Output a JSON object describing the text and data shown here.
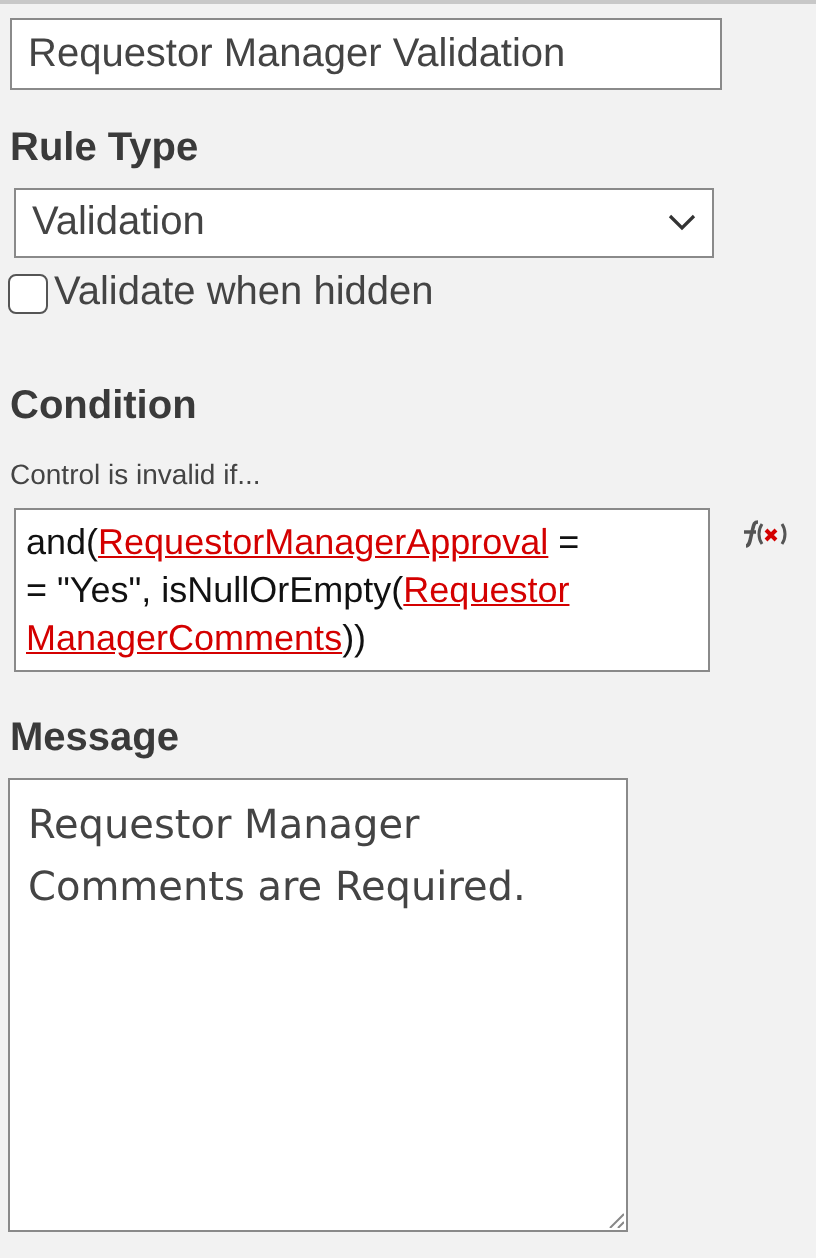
{
  "rule_name": {
    "value": "Requestor Manager Validation"
  },
  "rule_type": {
    "label": "Rule Type",
    "value": "Validation"
  },
  "validate_when_hidden": {
    "label": "Validate when hidden",
    "checked": false
  },
  "condition": {
    "label": "Condition",
    "hint": "Control is invalid if...",
    "expression_lines": [
      [
        {
          "kind": "text",
          "text": "and("
        },
        {
          "kind": "reference",
          "text": "RequestorManagerApproval"
        },
        {
          "kind": "text",
          "text": " ="
        }
      ],
      [
        {
          "kind": "text",
          "text": "= \"Yes\", isNullOrEmpty("
        },
        {
          "kind": "reference",
          "text": "Requestor"
        }
      ],
      [
        {
          "kind": "reference",
          "text": "ManagerComments"
        },
        {
          "kind": "text",
          "text": "))"
        }
      ]
    ]
  },
  "message": {
    "label": "Message",
    "value": "Requestor Manager Comments are Required."
  }
}
